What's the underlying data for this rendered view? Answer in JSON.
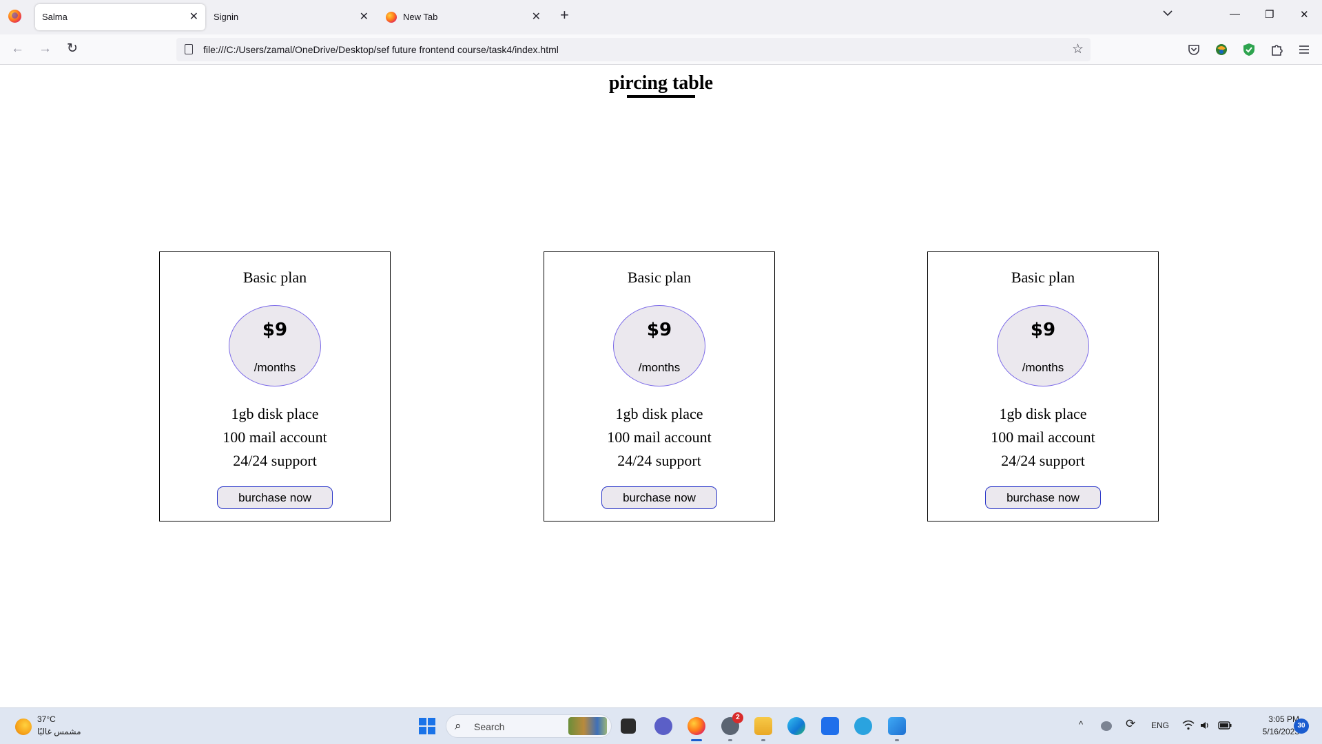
{
  "browser": {
    "tabs": [
      {
        "title": "Salma",
        "active": true
      },
      {
        "title": "Signin",
        "active": false
      },
      {
        "title": "New Tab",
        "active": false
      }
    ],
    "new_tab_symbol": "+",
    "close_symbol": "✕",
    "url": "file:///C:/Users/zamal/OneDrive/Desktop/sef future frontend course/task4/index.html",
    "nav": {
      "back": "←",
      "forward": "→",
      "reload": "↻"
    },
    "window_controls": {
      "minimize": "—",
      "restore": "❐",
      "close": "✕"
    },
    "bookmark_symbol": "☆",
    "toolbar_icons": [
      "pocket-icon",
      "extension-globe-icon",
      "shield-extension-icon",
      "extensions-icon",
      "menu-icon"
    ]
  },
  "page": {
    "title": "pircing table",
    "cards": [
      {
        "plan": "Basic plan",
        "price": "$9",
        "period": "/months",
        "features": [
          "1gb disk place",
          "100 mail account",
          "24/24 support"
        ],
        "button": "burchase now"
      },
      {
        "plan": "Basic plan",
        "price": "$9",
        "period": "/months",
        "features": [
          "1gb disk place",
          "100 mail account",
          "24/24 support"
        ],
        "button": "burchase now"
      },
      {
        "plan": "Basic plan",
        "price": "$9",
        "period": "/months",
        "features": [
          "1gb disk place",
          "100 mail account",
          "24/24 support"
        ],
        "button": "burchase now"
      }
    ],
    "colors": {
      "circle_fill": "#ebe8ee",
      "circle_border": "#7a68e8",
      "button_border": "#2a36c8"
    }
  },
  "taskbar": {
    "weather": {
      "temp": "37°C",
      "desc": "مشمس غالبًا"
    },
    "search_label": "Search",
    "apps": [
      "task-view-icon",
      "teams-chat-icon",
      "firefox-icon",
      "whatsapp-icon",
      "file-explorer-icon",
      "edge-icon",
      "store-icon",
      "telegram-icon",
      "photos-icon"
    ],
    "whatsapp_badge": "2",
    "tray": {
      "chevron": "^",
      "language": "ENG"
    },
    "clock": {
      "time": "3:05 PM",
      "date": "5/16/2023"
    },
    "notifications": "30"
  }
}
